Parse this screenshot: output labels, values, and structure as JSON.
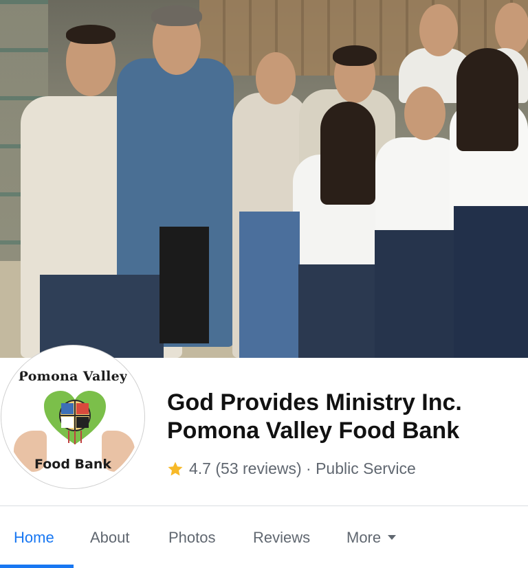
{
  "cover": {
    "description": ""
  },
  "profile": {
    "logo_top": "Pomona Valley",
    "logo_bottom": "Food Bank"
  },
  "page": {
    "title_line1": "God Provides Ministry Inc.",
    "title_line2": "Pomona Valley Food Bank",
    "rating": "4.7",
    "reviews": "(53 reviews)",
    "separator": "·",
    "category": "Public Service"
  },
  "tabs": [
    {
      "label": "Home",
      "active": true
    },
    {
      "label": "About"
    },
    {
      "label": "Photos"
    },
    {
      "label": "Reviews"
    },
    {
      "label": "More"
    }
  ],
  "colors": {
    "accent": "#1877f2",
    "star": "#f7b928",
    "muted": "#606770"
  },
  "icons": {
    "rating": "star-icon",
    "more": "chevron-down-icon"
  }
}
